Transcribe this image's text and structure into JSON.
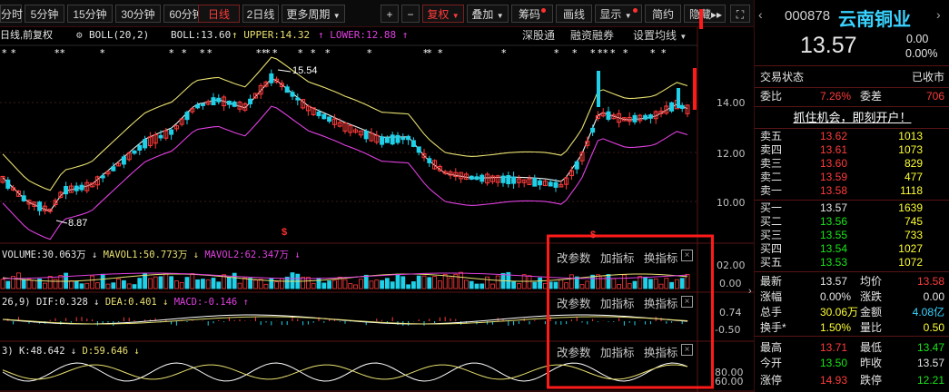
{
  "toolbar": {
    "periods": [
      "分时",
      "5分钟",
      "15分钟",
      "30分钟",
      "60分钟",
      "日线",
      "2日线",
      "更多周期"
    ],
    "active_period": "日线",
    "plus": "+",
    "minus": "−",
    "right_btns": [
      "复权",
      "叠加",
      "筹码",
      "画线",
      "显示",
      "简约",
      "隐藏"
    ],
    "more_arrow": "▸▸",
    "fullscreen": "⛶"
  },
  "infoline": {
    "prefix": "日线,前复权",
    "boll": "BOLL(20,2)",
    "boll_val": "BOLL:13.60",
    "upper": "UPPER:14.32",
    "lower": "LOWER:12.88",
    "tabs": [
      "深股通",
      "融资融券",
      "设置均线"
    ]
  },
  "annotations": {
    "high": "15.54",
    "low": "8.87",
    "marker": "$"
  },
  "axis": {
    "main": [
      "14.00",
      "12.00",
      "10.00"
    ],
    "vol": [
      "02.00",
      "0.00"
    ],
    "macd": [
      "0.74",
      "-0.50"
    ],
    "kdj": [
      "80.00",
      "60.00"
    ]
  },
  "volume": {
    "label": "VOLUME:30.063万",
    "mavol1": "MAVOL1:50.773万",
    "mavol2": "MAVOL2:62.347万"
  },
  "macd": {
    "prefix": "26,9)",
    "dif": "DIF:0.328",
    "dea": "DEA:0.401",
    "macd": "MACD:-0.146"
  },
  "kdj": {
    "prefix": "3)",
    "k": "K:48.642",
    "d": "D:59.646"
  },
  "subtools": [
    "改参数",
    "加指标",
    "换指标"
  ],
  "close": "×",
  "colors": {
    "up": "#ff3b3b",
    "down": "#1fd0e8",
    "upper": "#e8e070",
    "mid": "#f0f0f0",
    "lower": "#e040e0",
    "highlight": "#ff1a1a"
  },
  "quote": {
    "code": "000878",
    "name": "云南铜业",
    "price": "13.57",
    "change": "0.00",
    "change_pct": "0.00%",
    "status_label": "交易状态",
    "status": "已收市",
    "weibi_label": "委比",
    "weibi": "7.26%",
    "weicha_label": "委差",
    "weicha": "706",
    "promo": "抓住机会，即刻开户！",
    "sell": [
      {
        "label": "卖五",
        "price": "13.62",
        "vol": "1013"
      },
      {
        "label": "卖四",
        "price": "13.61",
        "vol": "1073"
      },
      {
        "label": "卖三",
        "price": "13.60",
        "vol": "829"
      },
      {
        "label": "卖二",
        "price": "13.59",
        "vol": "477"
      },
      {
        "label": "卖一",
        "price": "13.58",
        "vol": "1118"
      }
    ],
    "buy": [
      {
        "label": "买一",
        "price": "13.57",
        "vol": "1639"
      },
      {
        "label": "买二",
        "price": "13.56",
        "vol": "745"
      },
      {
        "label": "买三",
        "price": "13.55",
        "vol": "733"
      },
      {
        "label": "买四",
        "price": "13.54",
        "vol": "1027"
      },
      {
        "label": "买五",
        "price": "13.53",
        "vol": "1072"
      }
    ],
    "stats": [
      {
        "l1": "最新",
        "v1": "13.57",
        "l2": "均价",
        "v2": "13.58"
      },
      {
        "l1": "涨幅",
        "v1": "0.00%",
        "l2": "涨跌",
        "v2": "0.00"
      },
      {
        "l1": "总手",
        "v1": "30.06万",
        "l2": "金额",
        "v2": "4.08亿"
      },
      {
        "l1": "换手*",
        "v1": "1.50%",
        "l2": "量比",
        "v2": "0.50"
      },
      {
        "l1": "最高",
        "v1": "13.71",
        "l2": "最低",
        "v2": "13.47"
      },
      {
        "l1": "今开",
        "v1": "13.50",
        "l2": "昨收",
        "v2": "13.57"
      },
      {
        "l1": "涨停",
        "v1": "14.93",
        "l2": "跌停",
        "v2": "12.21"
      }
    ]
  }
}
